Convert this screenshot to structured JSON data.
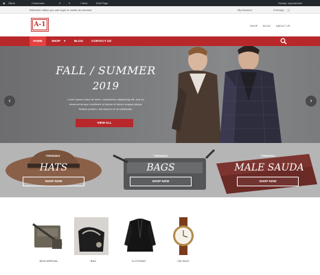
{
  "admin_bar": {
    "items": [
      "Sikhe",
      "Customize",
      "0",
      "0",
      "+ New",
      "Edit Page"
    ],
    "right": "Howdy, superadmin"
  },
  "welcome": {
    "message": "Welcome visitor you can login or create an account",
    "account": "My Account",
    "cart": "0 item(s)"
  },
  "logo": {
    "text": "A-1"
  },
  "top_links": [
    "SHOP",
    "BLOG",
    "ABOUT US"
  ],
  "nav": {
    "items": [
      "HOME",
      "SHOP",
      "BLOG",
      "CONTACT US"
    ]
  },
  "hero": {
    "title": "FALL / SUMMER",
    "year": "2019",
    "text_lines": [
      "Lorem ipsum dolor sit amet, consectetur adipisicing elit, sed do",
      "eiusmod tempor incididunt ut labore et dolore magna aliqua.",
      "Nullam pretium, fermentum mi at sollicitudin."
    ],
    "button": "VIEW ALL"
  },
  "categories": [
    {
      "tag": "TRENDING",
      "title": "HATS",
      "button": "SHOP NOW"
    },
    {
      "tag": "TRENDING",
      "title": "BAGS",
      "button": "SHOP NOW"
    },
    {
      "tag": "TRENDING",
      "title": "MALE SAUDA",
      "button": "SHOP NOW"
    }
  ],
  "products": [
    {
      "label": "NEW ARRIVAL"
    },
    {
      "label": "BAG"
    },
    {
      "label": "CLOTHING"
    },
    {
      "label": "ON SALE"
    }
  ],
  "colors": {
    "accent": "#b8282a",
    "accent_light": "#e34240",
    "admin_bar": "#23282d"
  }
}
